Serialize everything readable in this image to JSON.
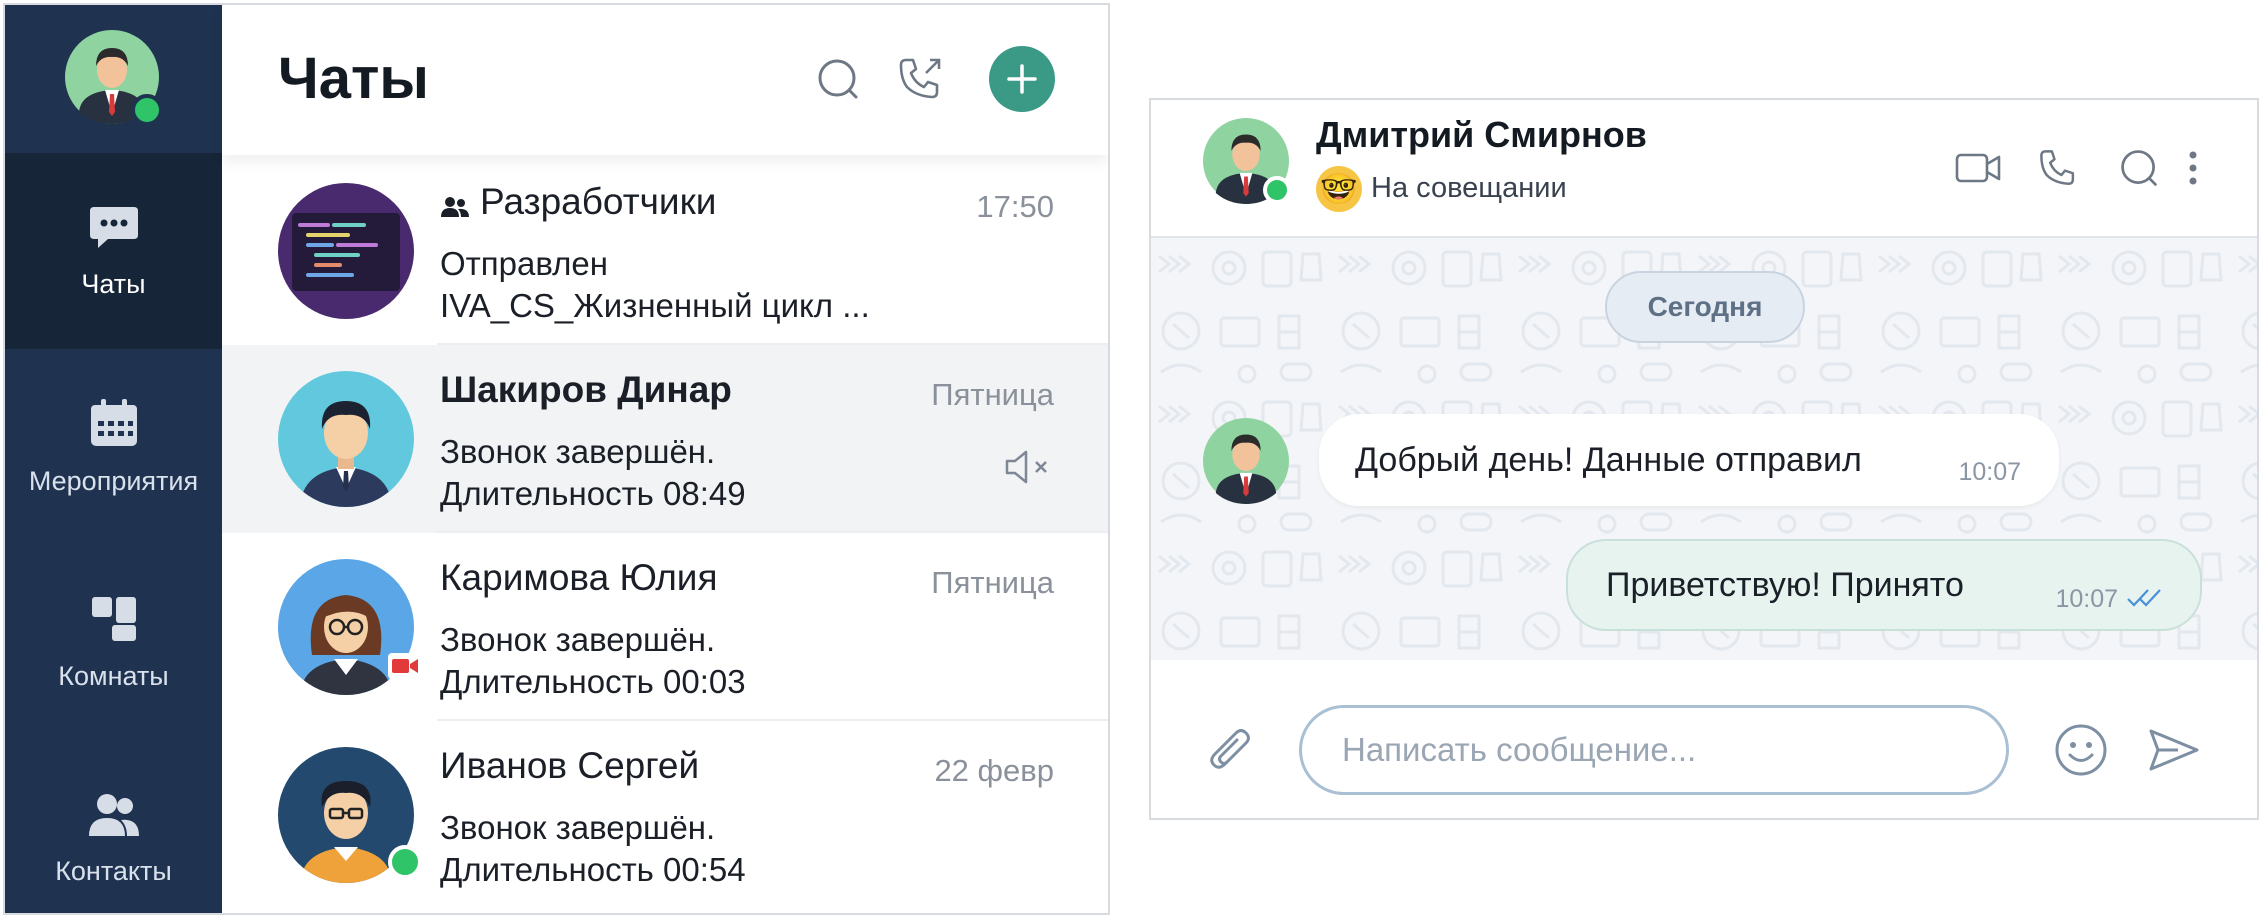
{
  "nav": {
    "items": [
      {
        "label": "Чаты",
        "icon": "chat-bubble-icon"
      },
      {
        "label": "Мероприятия",
        "icon": "calendar-icon"
      },
      {
        "label": "Комнаты",
        "icon": "rooms-icon"
      },
      {
        "label": "Контакты",
        "icon": "contacts-icon"
      }
    ],
    "active": "Чаты"
  },
  "list": {
    "title": "Чаты",
    "chats": [
      {
        "name": "Разработчики",
        "time": "17:50",
        "msg1": "Отправлен",
        "msg2": "IVA_CS_Жизненный цикл ...",
        "is_group": true
      },
      {
        "name": "Шакиров Динар",
        "time": "Пятница",
        "msg1": "Звонок завершён.",
        "msg2": "Длительность 08:49",
        "muted": true,
        "unread": true
      },
      {
        "name": "Каримова Юлия",
        "time": "Пятница",
        "msg1": "Звонок завершён.",
        "msg2": "Длительность 00:03"
      },
      {
        "name": "Иванов Сергей",
        "time": "22 февр",
        "msg1": "Звонок завершён.",
        "msg2": "Длительность 00:54"
      }
    ]
  },
  "conversation": {
    "contact_name": "Дмитрий Смирнов",
    "status": "На совещании",
    "status_emoji": "🤓",
    "date_divider": "Сегодня",
    "messages": [
      {
        "direction": "in",
        "text": "Добрый день! Данные отправил",
        "time": "10:07"
      },
      {
        "direction": "out",
        "text": "Приветствую! Принято",
        "time": "10:07",
        "read": true
      }
    ],
    "input_placeholder": "Написать сообщение..."
  },
  "colors": {
    "nav_bg": "#1f3350",
    "nav_active": "#162538",
    "accent": "#3b9a86",
    "online": "#2fc468",
    "read_check": "#4a90d9"
  }
}
